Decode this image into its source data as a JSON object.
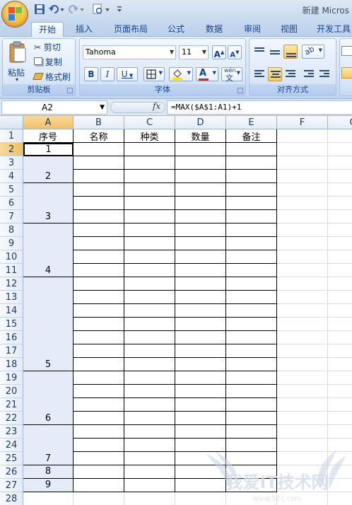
{
  "window": {
    "title": "新建 Micros"
  },
  "tabs": [
    {
      "label": "开始",
      "active": true
    },
    {
      "label": "插入"
    },
    {
      "label": "页面布局"
    },
    {
      "label": "公式"
    },
    {
      "label": "数据"
    },
    {
      "label": "审阅"
    },
    {
      "label": "视图"
    },
    {
      "label": "开发工具"
    }
  ],
  "ribbon": {
    "clipboard": {
      "paste": "粘贴",
      "cut": "剪切",
      "copy": "复制",
      "format_painter": "格式刷",
      "label": "剪贴板"
    },
    "font": {
      "font_name": "Tahoma",
      "font_size": "11",
      "bold": "B",
      "italic": "I",
      "underline": "U",
      "font_color_glyph": "A",
      "wen": "wén",
      "wen_char": "文",
      "label": "字体"
    },
    "alignment": {
      "label": "对齐方式"
    }
  },
  "formula_bar": {
    "name_box": "A2",
    "fx": "fx",
    "formula": "=MAX($A$1:A1)+1"
  },
  "sheet": {
    "columns": [
      "A",
      "B",
      "C",
      "D",
      "E",
      "F",
      "G"
    ],
    "rows": [
      "1",
      "2",
      "3",
      "4",
      "5",
      "6",
      "7",
      "8",
      "9",
      "10",
      "11",
      "12",
      "13",
      "14",
      "15",
      "16",
      "17",
      "18",
      "19",
      "20",
      "21",
      "22",
      "23",
      "24",
      "25",
      "26",
      "27",
      "28"
    ],
    "headers": [
      "序号",
      "名称",
      "种类",
      "数量",
      "备注"
    ],
    "a_values": [
      "1",
      "2",
      "3",
      "4",
      "5",
      "6",
      "7",
      "8",
      "9"
    ],
    "selected_cell": "A2"
  },
  "colors": {
    "selection_header": "#f1c15f",
    "merged_fill": "#e6ecf7",
    "ribbon_text": "#15428b"
  }
}
